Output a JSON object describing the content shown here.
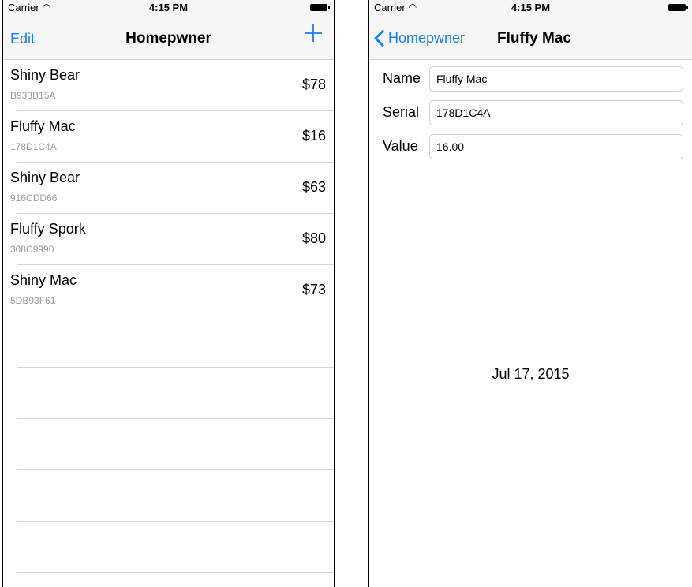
{
  "status_bar": {
    "carrier": "Carrier",
    "time": "4:15 PM"
  },
  "list_screen": {
    "nav": {
      "edit_label": "Edit",
      "title": "Homepwner",
      "add_icon": "plus-icon"
    },
    "items": [
      {
        "name": "Shiny Bear",
        "serial": "B933B15A",
        "value": "$78"
      },
      {
        "name": "Fluffy Mac",
        "serial": "178D1C4A",
        "value": "$16"
      },
      {
        "name": "Shiny Bear",
        "serial": "916CDD66",
        "value": "$63"
      },
      {
        "name": "Fluffy Spork",
        "serial": "308C9990",
        "value": "$80"
      },
      {
        "name": "Shiny Mac",
        "serial": "5DB93F61",
        "value": "$73"
      }
    ]
  },
  "detail_screen": {
    "nav": {
      "back_label": "Homepwner",
      "title": "Fluffy Mac"
    },
    "fields": {
      "name_label": "Name",
      "name_value": "Fluffy Mac",
      "serial_label": "Serial",
      "serial_value": "178D1C4A",
      "value_label": "Value",
      "value_value": "16.00"
    },
    "date_created": "Jul 17, 2015"
  },
  "colors": {
    "tint": "#1a7cf5",
    "bar_background": "#f7f7f7",
    "separator": "#d6d6d6",
    "secondary_text": "#9b9b9b"
  }
}
